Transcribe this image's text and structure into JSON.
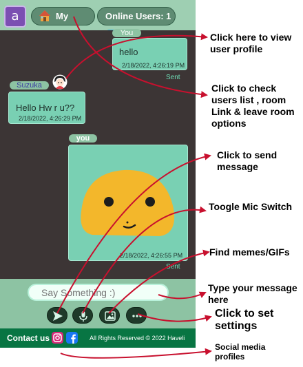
{
  "header": {
    "avatar_letter": "a",
    "room_label": "My Room",
    "online_users_label": "Online Users: 1"
  },
  "messages": [
    {
      "sender": "You",
      "text": "hello",
      "timestamp": "2/18/2022, 4:26:19 PM",
      "status": "Sent"
    },
    {
      "sender": "Suzuka",
      "text": "Hello Hw r u??",
      "timestamp": "2/18/2022, 4:26:29 PM"
    },
    {
      "sender": "you",
      "timestamp": "2/18/2022, 4:26:55 PM",
      "status": "Sent",
      "content": "emoji-sticker"
    }
  ],
  "composer": {
    "placeholder": "Say Something :)"
  },
  "footer": {
    "contact_label": "Contact us :",
    "rights": "All Rights Reserved © 2022 Haveli"
  },
  "annotations": {
    "profile": "Click here to view user profile",
    "options": "Click to check users list , room Link & leave room options",
    "send": "Click to send message",
    "mic": "Toogle Mic Switch",
    "memes": "Find memes/GIFs",
    "type": "Type your message here",
    "settings": "Click to set settings",
    "social": "Social media profiles"
  },
  "colors": {
    "accent": "#8dc3a3",
    "chat_background": "#3c3535",
    "bubble": "#79d0b3",
    "footer": "#087543",
    "arrow": "#c8102e"
  },
  "icons": [
    "home-icon",
    "users-icon",
    "send-icon",
    "mic-icon",
    "image-icon",
    "more-icon",
    "instagram-icon",
    "facebook-icon"
  ]
}
